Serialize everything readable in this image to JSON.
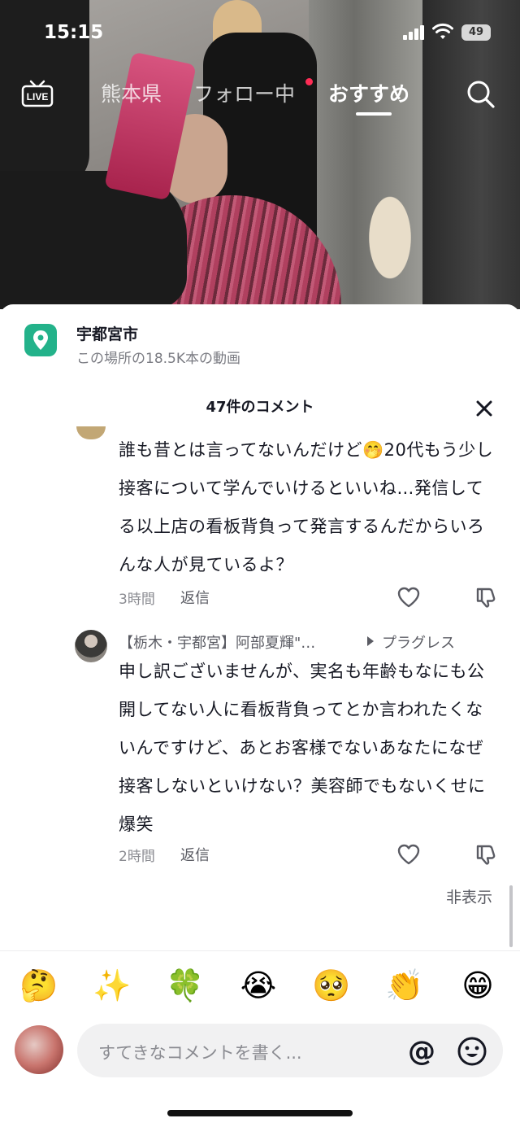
{
  "status_bar": {
    "time": "15:15",
    "battery": "49"
  },
  "top_nav": {
    "live_icon": "live-tv-icon",
    "tabs": [
      {
        "label": "熊本県",
        "active": false
      },
      {
        "label": "フォロー中",
        "active": false
      },
      {
        "label": "おすすめ",
        "active": true
      }
    ],
    "search_icon": "search-icon"
  },
  "location": {
    "name": "宇都宮市",
    "subtitle": "この場所の18.5K本の動画",
    "icon": "map-pin-icon"
  },
  "comments_header": {
    "title": "47件のコメント",
    "close_icon": "close-icon"
  },
  "comments": [
    {
      "text": "誰も昔とは言ってないんだけど🤭20代もう少し接客について学んでいけるといいね…発信してる以上店の看板背負って発言するんだからいろんな人が見ているよ？",
      "time": "3時間",
      "reply_label": "返信"
    }
  ],
  "reply": {
    "author": "【栃木・宇都宮】阿部夏輝\"…",
    "reply_to": "プラグレス",
    "text": "申し訳ございませんが、実名も年齢もなにも公開してない人に看板背負ってとか言われたくないんですけど、あとお客様でないあなたになぜ接客しないといけない？美容師でもないくせに爆笑",
    "time": "2時間",
    "reply_label": "返信"
  },
  "hide_label": "非表示",
  "emoji_bar": [
    "🤔",
    "✨",
    "🍀",
    "😭",
    "🥺",
    "👏",
    "😁"
  ],
  "input": {
    "placeholder": "すてきなコメントを書く...",
    "at_symbol": "@"
  },
  "colors": {
    "accent_red": "#fe2c55",
    "location_green": "#23b28a"
  }
}
